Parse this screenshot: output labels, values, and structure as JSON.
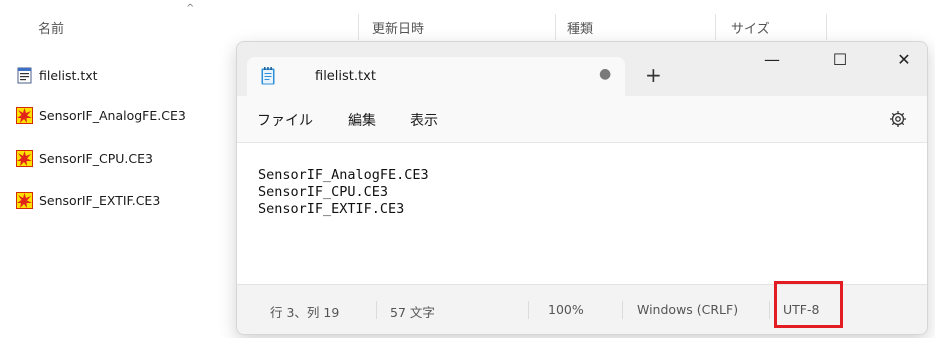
{
  "explorer": {
    "columns": {
      "name": "名前",
      "modified": "更新日時",
      "type": "種類",
      "size": "サイズ"
    },
    "files": [
      {
        "name": "filelist.txt",
        "icon": "text-file-icon"
      },
      {
        "name": "SensorIF_AnalogFE.CE3",
        "icon": "ce3-file-icon"
      },
      {
        "name": "SensorIF_CPU.CE3",
        "icon": "ce3-file-icon"
      },
      {
        "name": "SensorIF_EXTIF.CE3",
        "icon": "ce3-file-icon"
      }
    ]
  },
  "notepad": {
    "tab": {
      "title": "filelist.txt",
      "unsaved_marker": "●",
      "new_tab": "+"
    },
    "window_controls": {
      "minimize": "—",
      "maximize": "☐",
      "close": "✕"
    },
    "menu": {
      "file": "ファイル",
      "edit": "編集",
      "view": "表示"
    },
    "content": "SensorIF_AnalogFE.CE3\nSensorIF_CPU.CE3\nSensorIF_EXTIF.CE3",
    "status": {
      "position": "行 3、列 19",
      "char_count": "57 文字",
      "zoom": "100%",
      "line_ending": "Windows (CRLF)",
      "encoding": "UTF-8"
    },
    "highlight_color": "#e31b23"
  }
}
